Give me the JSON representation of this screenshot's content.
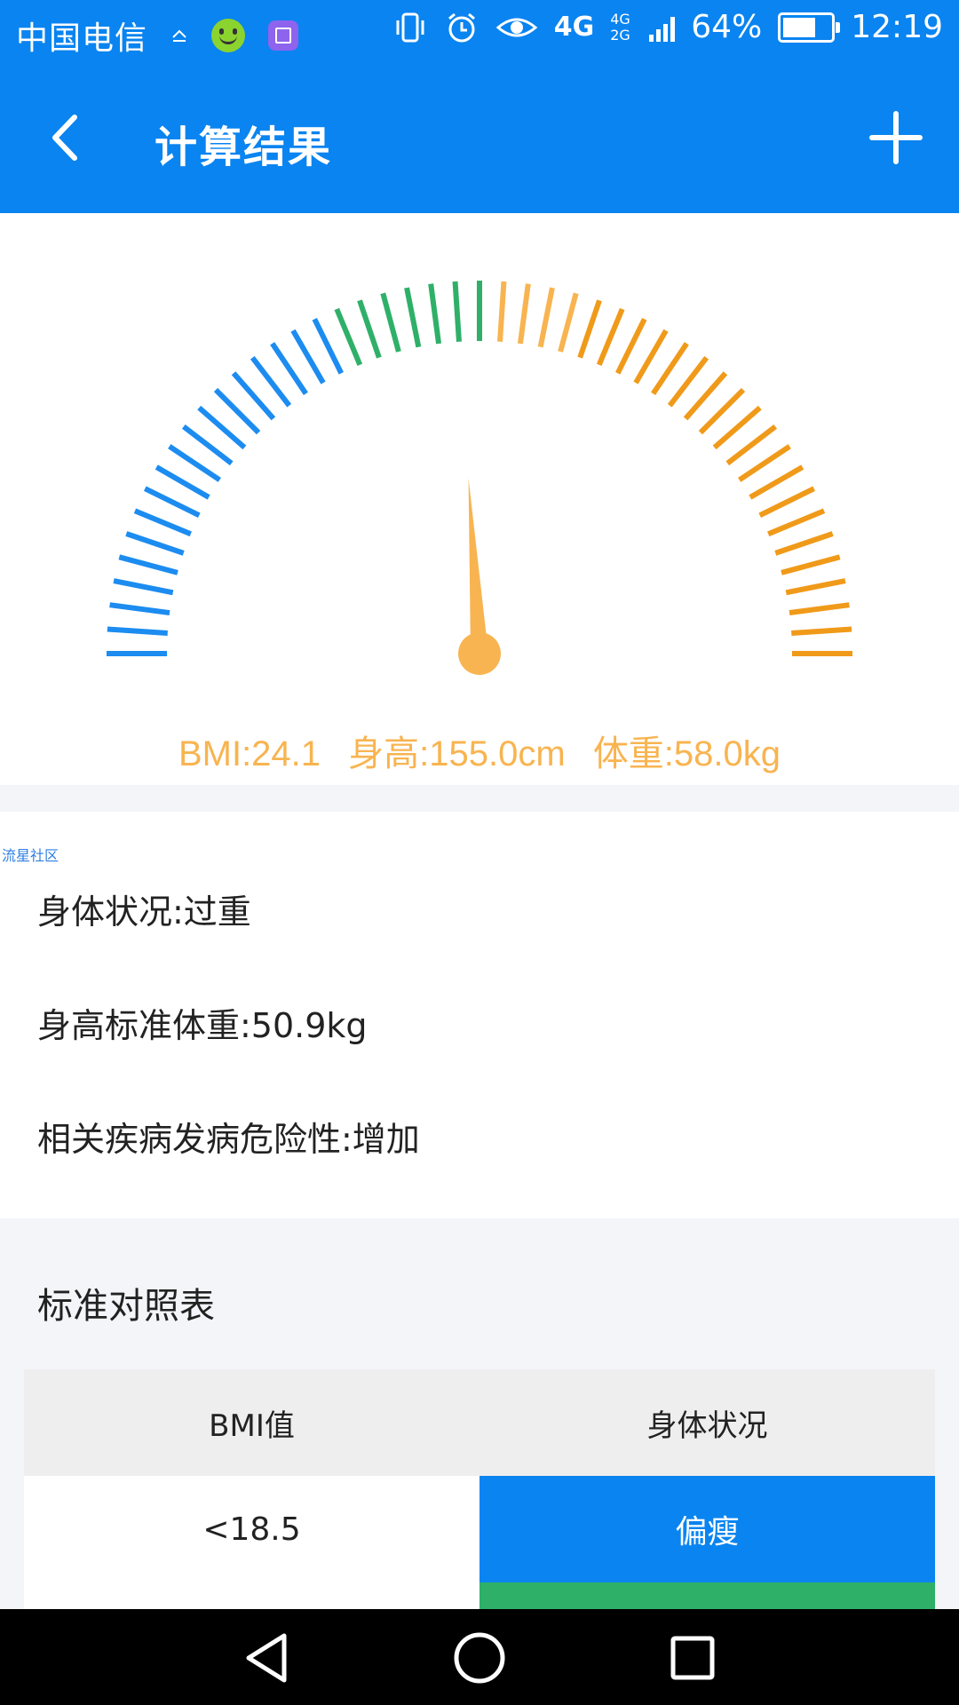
{
  "status_bar": {
    "carrier": "中国电信",
    "network": "4G",
    "network_secondary": "4G 2G",
    "battery": "64%",
    "time": "12:19"
  },
  "app_bar": {
    "title": "计算结果"
  },
  "gauge": {
    "needle_value_fraction": 0.48,
    "zone_colors": {
      "low": "#1c8cf0",
      "normal": "#2fb068",
      "high_light": "#f8b450",
      "high": "#f09a1a"
    }
  },
  "result": {
    "bmi": "BMI:24.1",
    "height": "身高:155.0cm",
    "weight": "体重:58.0kg"
  },
  "info": {
    "watermark": "流星社区",
    "condition": "身体状况:过重",
    "standard_weight": "身高标准体重:50.9kg",
    "risk": "相关疾病发病危险性:增加"
  },
  "reference_table": {
    "title": "标准对照表",
    "headers": [
      "BMI值",
      "身体状况"
    ],
    "rows": [
      {
        "bmi": "<18.5",
        "status": "偏瘦"
      }
    ]
  }
}
